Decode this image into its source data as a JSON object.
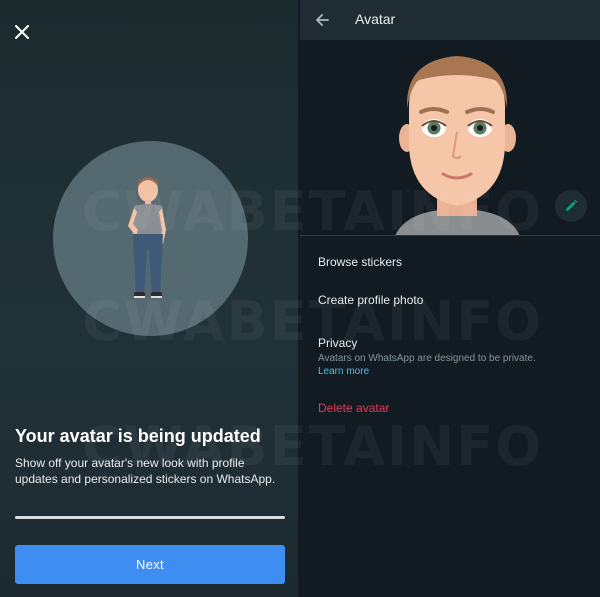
{
  "left_screen": {
    "headline": "Your avatar is being updated",
    "description": "Show off your avatar's new look with profile updates and personalized stickers on WhatsApp.",
    "progress": 1.0,
    "next_label": "Next",
    "icons": {
      "close": "close-icon"
    }
  },
  "right_screen": {
    "title": "Avatar",
    "menu": {
      "browse_stickers": "Browse stickers",
      "create_profile_photo": "Create profile photo",
      "privacy": "Privacy",
      "privacy_description": "Avatars on WhatsApp are designed to be private.",
      "learn_more": "Learn more",
      "delete_avatar": "Delete avatar"
    },
    "icons": {
      "back": "back-arrow-icon",
      "edit": "pencil-icon"
    }
  },
  "watermark": "CWABETAINFO",
  "colors": {
    "accent_button": "#3d8ef0",
    "edit_icon": "#00a884",
    "link": "#53bdeb",
    "danger": "#e33a5b"
  }
}
